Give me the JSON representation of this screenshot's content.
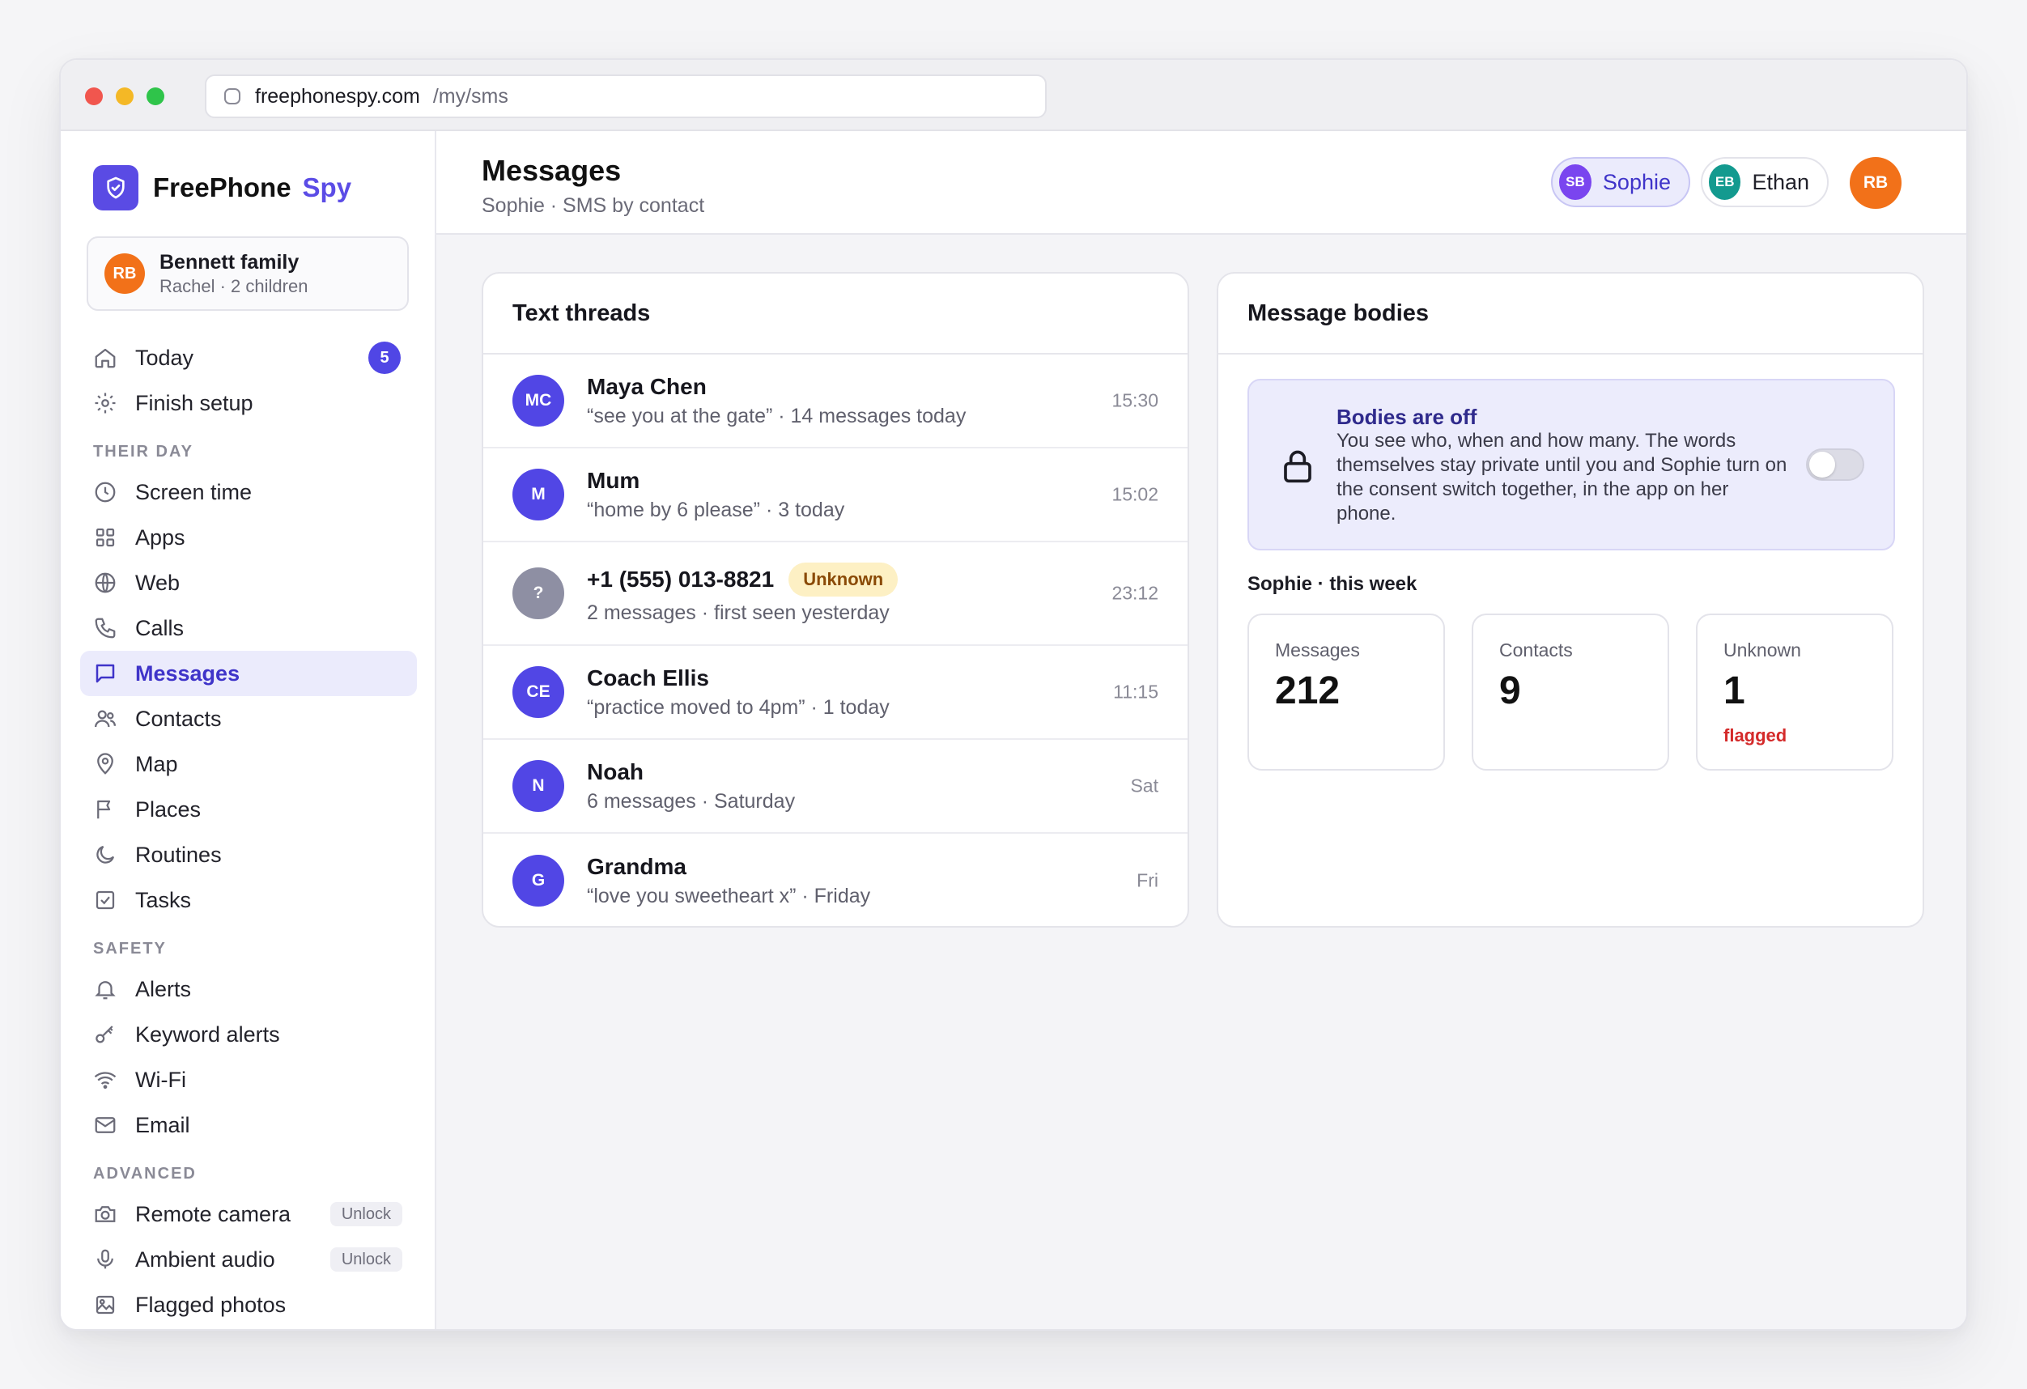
{
  "browser": {
    "domain": "freephonespy.com",
    "path": "/my/sms"
  },
  "brand": {
    "name": "FreePhone",
    "accent": "Spy",
    "accent_color": "#5b4ce6"
  },
  "family": {
    "initials": "RB",
    "name": "Bennett family",
    "sub": "Rachel · 2 children"
  },
  "nav": {
    "top": [
      {
        "label": "Today",
        "icon": "home-icon",
        "badge": "5"
      },
      {
        "label": "Finish setup",
        "icon": "gear-icon"
      }
    ],
    "their_day_title": "THEIR DAY",
    "their_day": [
      {
        "label": "Screen time",
        "icon": "clock-icon"
      },
      {
        "label": "Apps",
        "icon": "grid-icon"
      },
      {
        "label": "Web",
        "icon": "globe-icon"
      },
      {
        "label": "Calls",
        "icon": "phone-icon"
      },
      {
        "label": "Messages",
        "icon": "chat-icon",
        "active": true
      },
      {
        "label": "Contacts",
        "icon": "users-icon"
      },
      {
        "label": "Map",
        "icon": "pin-icon"
      },
      {
        "label": "Places",
        "icon": "flag-icon"
      },
      {
        "label": "Routines",
        "icon": "moon-icon"
      },
      {
        "label": "Tasks",
        "icon": "checkbox-icon"
      }
    ],
    "safety_title": "SAFETY",
    "safety": [
      {
        "label": "Alerts",
        "icon": "bell-icon"
      },
      {
        "label": "Keyword alerts",
        "icon": "key-icon"
      },
      {
        "label": "Wi-Fi",
        "icon": "wifi-icon"
      },
      {
        "label": "Email",
        "icon": "mail-icon"
      }
    ],
    "advanced_title": "ADVANCED",
    "advanced": [
      {
        "label": "Remote camera",
        "icon": "camera-icon",
        "pill": "Unlock"
      },
      {
        "label": "Ambient audio",
        "icon": "mic-icon",
        "pill": "Unlock"
      },
      {
        "label": "Flagged photos",
        "icon": "image-icon"
      }
    ]
  },
  "header": {
    "title": "Messages",
    "subtitle": "Sophie · SMS by contact",
    "children": [
      {
        "initials": "SB",
        "name": "Sophie"
      },
      {
        "initials": "EB",
        "name": "Ethan"
      }
    ],
    "user_initials": "RB"
  },
  "threads": {
    "title": "Text threads",
    "items": [
      {
        "initials": "MC",
        "name": "Maya Chen",
        "preview": "“see you at the gate” · 14 messages today",
        "time": "15:30"
      },
      {
        "initials": "M",
        "name": "Mum",
        "preview": "“home by 6 please” · 3 today",
        "time": "15:02"
      },
      {
        "initials": "?",
        "name": "+1 (555) 013-8821",
        "badge": "Unknown",
        "preview": "2 messages · first seen yesterday",
        "time": "23:12"
      },
      {
        "initials": "CE",
        "name": "Coach Ellis",
        "preview": "“practice moved to 4pm” · 1 today",
        "time": "11:15"
      },
      {
        "initials": "N",
        "name": "Noah",
        "preview": "6 messages · Saturday",
        "time": "Sat"
      },
      {
        "initials": "G",
        "name": "Grandma",
        "preview": "“love you sweetheart x” · Friday",
        "time": "Fri"
      }
    ]
  },
  "bodies": {
    "title": "Message bodies",
    "consent_title": "Bodies are off",
    "consent_text": "You see who, when and how many. The words themselves stay private until you and Sophie turn on the consent switch together, in the app on her phone.",
    "toggle_on": false,
    "week_label": "Sophie · this week",
    "stats": [
      {
        "label": "Messages",
        "value": "212"
      },
      {
        "label": "Contacts",
        "value": "9"
      },
      {
        "label": "Unknown",
        "value": "1",
        "note": "flagged"
      }
    ]
  }
}
